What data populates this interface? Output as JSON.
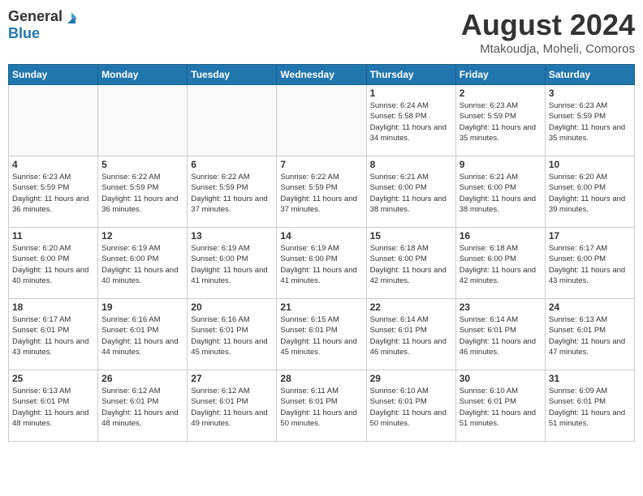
{
  "header": {
    "logo_general": "General",
    "logo_blue": "Blue",
    "month_year": "August 2024",
    "location": "Mtakoudja, Moheli, Comoros"
  },
  "days_of_week": [
    "Sunday",
    "Monday",
    "Tuesday",
    "Wednesday",
    "Thursday",
    "Friday",
    "Saturday"
  ],
  "weeks": [
    [
      {
        "day": "",
        "info": ""
      },
      {
        "day": "",
        "info": ""
      },
      {
        "day": "",
        "info": ""
      },
      {
        "day": "",
        "info": ""
      },
      {
        "day": "1",
        "info": "Sunrise: 6:24 AM\nSunset: 5:58 PM\nDaylight: 11 hours and 34 minutes."
      },
      {
        "day": "2",
        "info": "Sunrise: 6:23 AM\nSunset: 5:59 PM\nDaylight: 11 hours and 35 minutes."
      },
      {
        "day": "3",
        "info": "Sunrise: 6:23 AM\nSunset: 5:59 PM\nDaylight: 11 hours and 35 minutes."
      }
    ],
    [
      {
        "day": "4",
        "info": "Sunrise: 6:23 AM\nSunset: 5:59 PM\nDaylight: 11 hours and 36 minutes."
      },
      {
        "day": "5",
        "info": "Sunrise: 6:22 AM\nSunset: 5:59 PM\nDaylight: 11 hours and 36 minutes."
      },
      {
        "day": "6",
        "info": "Sunrise: 6:22 AM\nSunset: 5:59 PM\nDaylight: 11 hours and 37 minutes."
      },
      {
        "day": "7",
        "info": "Sunrise: 6:22 AM\nSunset: 5:59 PM\nDaylight: 11 hours and 37 minutes."
      },
      {
        "day": "8",
        "info": "Sunrise: 6:21 AM\nSunset: 6:00 PM\nDaylight: 11 hours and 38 minutes."
      },
      {
        "day": "9",
        "info": "Sunrise: 6:21 AM\nSunset: 6:00 PM\nDaylight: 11 hours and 38 minutes."
      },
      {
        "day": "10",
        "info": "Sunrise: 6:20 AM\nSunset: 6:00 PM\nDaylight: 11 hours and 39 minutes."
      }
    ],
    [
      {
        "day": "11",
        "info": "Sunrise: 6:20 AM\nSunset: 6:00 PM\nDaylight: 11 hours and 40 minutes."
      },
      {
        "day": "12",
        "info": "Sunrise: 6:19 AM\nSunset: 6:00 PM\nDaylight: 11 hours and 40 minutes."
      },
      {
        "day": "13",
        "info": "Sunrise: 6:19 AM\nSunset: 6:00 PM\nDaylight: 11 hours and 41 minutes."
      },
      {
        "day": "14",
        "info": "Sunrise: 6:19 AM\nSunset: 6:00 PM\nDaylight: 11 hours and 41 minutes."
      },
      {
        "day": "15",
        "info": "Sunrise: 6:18 AM\nSunset: 6:00 PM\nDaylight: 11 hours and 42 minutes."
      },
      {
        "day": "16",
        "info": "Sunrise: 6:18 AM\nSunset: 6:00 PM\nDaylight: 11 hours and 42 minutes."
      },
      {
        "day": "17",
        "info": "Sunrise: 6:17 AM\nSunset: 6:00 PM\nDaylight: 11 hours and 43 minutes."
      }
    ],
    [
      {
        "day": "18",
        "info": "Sunrise: 6:17 AM\nSunset: 6:01 PM\nDaylight: 11 hours and 43 minutes."
      },
      {
        "day": "19",
        "info": "Sunrise: 6:16 AM\nSunset: 6:01 PM\nDaylight: 11 hours and 44 minutes."
      },
      {
        "day": "20",
        "info": "Sunrise: 6:16 AM\nSunset: 6:01 PM\nDaylight: 11 hours and 45 minutes."
      },
      {
        "day": "21",
        "info": "Sunrise: 6:15 AM\nSunset: 6:01 PM\nDaylight: 11 hours and 45 minutes."
      },
      {
        "day": "22",
        "info": "Sunrise: 6:14 AM\nSunset: 6:01 PM\nDaylight: 11 hours and 46 minutes."
      },
      {
        "day": "23",
        "info": "Sunrise: 6:14 AM\nSunset: 6:01 PM\nDaylight: 11 hours and 46 minutes."
      },
      {
        "day": "24",
        "info": "Sunrise: 6:13 AM\nSunset: 6:01 PM\nDaylight: 11 hours and 47 minutes."
      }
    ],
    [
      {
        "day": "25",
        "info": "Sunrise: 6:13 AM\nSunset: 6:01 PM\nDaylight: 11 hours and 48 minutes."
      },
      {
        "day": "26",
        "info": "Sunrise: 6:12 AM\nSunset: 6:01 PM\nDaylight: 11 hours and 48 minutes."
      },
      {
        "day": "27",
        "info": "Sunrise: 6:12 AM\nSunset: 6:01 PM\nDaylight: 11 hours and 49 minutes."
      },
      {
        "day": "28",
        "info": "Sunrise: 6:11 AM\nSunset: 6:01 PM\nDaylight: 11 hours and 50 minutes."
      },
      {
        "day": "29",
        "info": "Sunrise: 6:10 AM\nSunset: 6:01 PM\nDaylight: 11 hours and 50 minutes."
      },
      {
        "day": "30",
        "info": "Sunrise: 6:10 AM\nSunset: 6:01 PM\nDaylight: 11 hours and 51 minutes."
      },
      {
        "day": "31",
        "info": "Sunrise: 6:09 AM\nSunset: 6:01 PM\nDaylight: 11 hours and 51 minutes."
      }
    ]
  ]
}
